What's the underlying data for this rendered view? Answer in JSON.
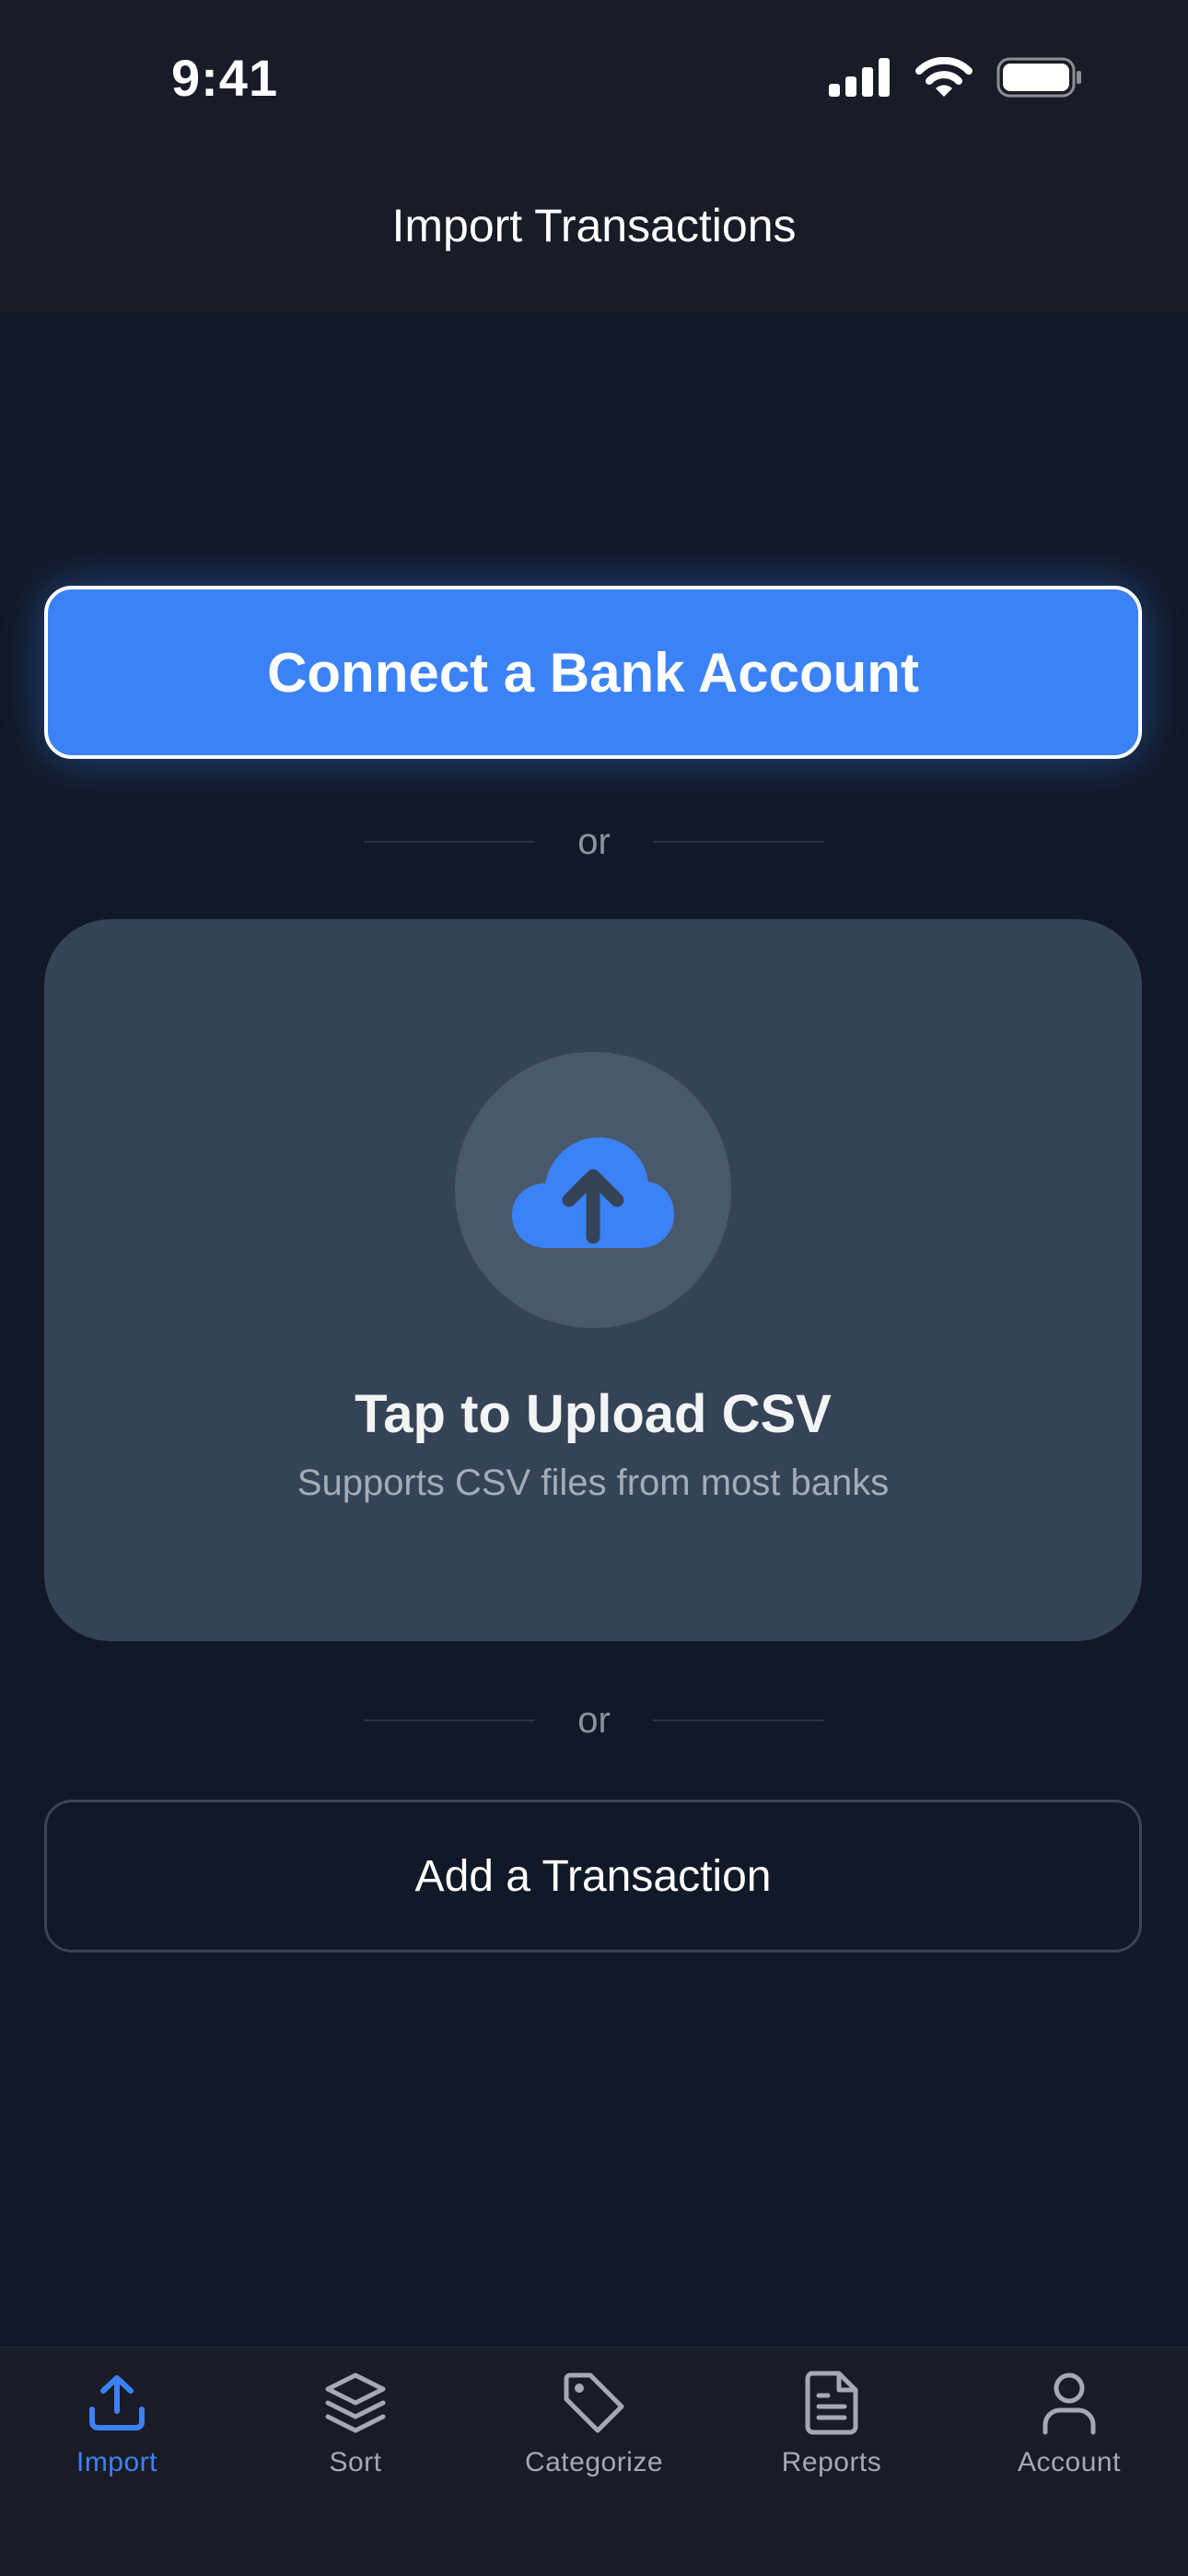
{
  "status_bar": {
    "time": "9:41"
  },
  "header": {
    "title": "Import Transactions"
  },
  "connect_bank": {
    "label": "Connect a Bank Account"
  },
  "dividers": {
    "or_label": "or"
  },
  "upload_card": {
    "icon": "cloud-upload-icon",
    "title": "Tap to Upload CSV",
    "subtitle": "Supports CSV files from most banks"
  },
  "add_transaction": {
    "label": "Add a Transaction"
  },
  "tab_bar": {
    "active_tab": "Import",
    "tabs": [
      {
        "label": "Import",
        "icon": "upload-icon"
      },
      {
        "label": "Sort",
        "icon": "layers-icon"
      },
      {
        "label": "Categorize",
        "icon": "tag-icon"
      },
      {
        "label": "Reports",
        "icon": "document-icon"
      },
      {
        "label": "Account",
        "icon": "user-icon"
      }
    ]
  },
  "colors": {
    "background": "#111827",
    "accent": "#3b82f6",
    "card": "#354356",
    "tab_bar": "#191b26"
  }
}
